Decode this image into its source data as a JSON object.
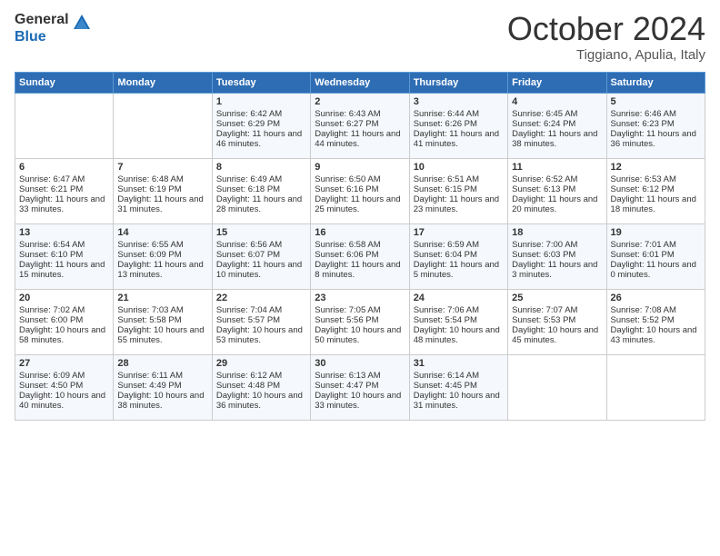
{
  "logo": {
    "general": "General",
    "blue": "Blue"
  },
  "title": "October 2024",
  "location": "Tiggiano, Apulia, Italy",
  "days_header": [
    "Sunday",
    "Monday",
    "Tuesday",
    "Wednesday",
    "Thursday",
    "Friday",
    "Saturday"
  ],
  "weeks": [
    [
      {
        "day": "",
        "sunrise": "",
        "sunset": "",
        "daylight": ""
      },
      {
        "day": "",
        "sunrise": "",
        "sunset": "",
        "daylight": ""
      },
      {
        "day": "1",
        "sunrise": "Sunrise: 6:42 AM",
        "sunset": "Sunset: 6:29 PM",
        "daylight": "Daylight: 11 hours and 46 minutes."
      },
      {
        "day": "2",
        "sunrise": "Sunrise: 6:43 AM",
        "sunset": "Sunset: 6:27 PM",
        "daylight": "Daylight: 11 hours and 44 minutes."
      },
      {
        "day": "3",
        "sunrise": "Sunrise: 6:44 AM",
        "sunset": "Sunset: 6:26 PM",
        "daylight": "Daylight: 11 hours and 41 minutes."
      },
      {
        "day": "4",
        "sunrise": "Sunrise: 6:45 AM",
        "sunset": "Sunset: 6:24 PM",
        "daylight": "Daylight: 11 hours and 38 minutes."
      },
      {
        "day": "5",
        "sunrise": "Sunrise: 6:46 AM",
        "sunset": "Sunset: 6:23 PM",
        "daylight": "Daylight: 11 hours and 36 minutes."
      }
    ],
    [
      {
        "day": "6",
        "sunrise": "Sunrise: 6:47 AM",
        "sunset": "Sunset: 6:21 PM",
        "daylight": "Daylight: 11 hours and 33 minutes."
      },
      {
        "day": "7",
        "sunrise": "Sunrise: 6:48 AM",
        "sunset": "Sunset: 6:19 PM",
        "daylight": "Daylight: 11 hours and 31 minutes."
      },
      {
        "day": "8",
        "sunrise": "Sunrise: 6:49 AM",
        "sunset": "Sunset: 6:18 PM",
        "daylight": "Daylight: 11 hours and 28 minutes."
      },
      {
        "day": "9",
        "sunrise": "Sunrise: 6:50 AM",
        "sunset": "Sunset: 6:16 PM",
        "daylight": "Daylight: 11 hours and 25 minutes."
      },
      {
        "day": "10",
        "sunrise": "Sunrise: 6:51 AM",
        "sunset": "Sunset: 6:15 PM",
        "daylight": "Daylight: 11 hours and 23 minutes."
      },
      {
        "day": "11",
        "sunrise": "Sunrise: 6:52 AM",
        "sunset": "Sunset: 6:13 PM",
        "daylight": "Daylight: 11 hours and 20 minutes."
      },
      {
        "day": "12",
        "sunrise": "Sunrise: 6:53 AM",
        "sunset": "Sunset: 6:12 PM",
        "daylight": "Daylight: 11 hours and 18 minutes."
      }
    ],
    [
      {
        "day": "13",
        "sunrise": "Sunrise: 6:54 AM",
        "sunset": "Sunset: 6:10 PM",
        "daylight": "Daylight: 11 hours and 15 minutes."
      },
      {
        "day": "14",
        "sunrise": "Sunrise: 6:55 AM",
        "sunset": "Sunset: 6:09 PM",
        "daylight": "Daylight: 11 hours and 13 minutes."
      },
      {
        "day": "15",
        "sunrise": "Sunrise: 6:56 AM",
        "sunset": "Sunset: 6:07 PM",
        "daylight": "Daylight: 11 hours and 10 minutes."
      },
      {
        "day": "16",
        "sunrise": "Sunrise: 6:58 AM",
        "sunset": "Sunset: 6:06 PM",
        "daylight": "Daylight: 11 hours and 8 minutes."
      },
      {
        "day": "17",
        "sunrise": "Sunrise: 6:59 AM",
        "sunset": "Sunset: 6:04 PM",
        "daylight": "Daylight: 11 hours and 5 minutes."
      },
      {
        "day": "18",
        "sunrise": "Sunrise: 7:00 AM",
        "sunset": "Sunset: 6:03 PM",
        "daylight": "Daylight: 11 hours and 3 minutes."
      },
      {
        "day": "19",
        "sunrise": "Sunrise: 7:01 AM",
        "sunset": "Sunset: 6:01 PM",
        "daylight": "Daylight: 11 hours and 0 minutes."
      }
    ],
    [
      {
        "day": "20",
        "sunrise": "Sunrise: 7:02 AM",
        "sunset": "Sunset: 6:00 PM",
        "daylight": "Daylight: 10 hours and 58 minutes."
      },
      {
        "day": "21",
        "sunrise": "Sunrise: 7:03 AM",
        "sunset": "Sunset: 5:58 PM",
        "daylight": "Daylight: 10 hours and 55 minutes."
      },
      {
        "day": "22",
        "sunrise": "Sunrise: 7:04 AM",
        "sunset": "Sunset: 5:57 PM",
        "daylight": "Daylight: 10 hours and 53 minutes."
      },
      {
        "day": "23",
        "sunrise": "Sunrise: 7:05 AM",
        "sunset": "Sunset: 5:56 PM",
        "daylight": "Daylight: 10 hours and 50 minutes."
      },
      {
        "day": "24",
        "sunrise": "Sunrise: 7:06 AM",
        "sunset": "Sunset: 5:54 PM",
        "daylight": "Daylight: 10 hours and 48 minutes."
      },
      {
        "day": "25",
        "sunrise": "Sunrise: 7:07 AM",
        "sunset": "Sunset: 5:53 PM",
        "daylight": "Daylight: 10 hours and 45 minutes."
      },
      {
        "day": "26",
        "sunrise": "Sunrise: 7:08 AM",
        "sunset": "Sunset: 5:52 PM",
        "daylight": "Daylight: 10 hours and 43 minutes."
      }
    ],
    [
      {
        "day": "27",
        "sunrise": "Sunrise: 6:09 AM",
        "sunset": "Sunset: 4:50 PM",
        "daylight": "Daylight: 10 hours and 40 minutes."
      },
      {
        "day": "28",
        "sunrise": "Sunrise: 6:11 AM",
        "sunset": "Sunset: 4:49 PM",
        "daylight": "Daylight: 10 hours and 38 minutes."
      },
      {
        "day": "29",
        "sunrise": "Sunrise: 6:12 AM",
        "sunset": "Sunset: 4:48 PM",
        "daylight": "Daylight: 10 hours and 36 minutes."
      },
      {
        "day": "30",
        "sunrise": "Sunrise: 6:13 AM",
        "sunset": "Sunset: 4:47 PM",
        "daylight": "Daylight: 10 hours and 33 minutes."
      },
      {
        "day": "31",
        "sunrise": "Sunrise: 6:14 AM",
        "sunset": "Sunset: 4:45 PM",
        "daylight": "Daylight: 10 hours and 31 minutes."
      },
      {
        "day": "",
        "sunrise": "",
        "sunset": "",
        "daylight": ""
      },
      {
        "day": "",
        "sunrise": "",
        "sunset": "",
        "daylight": ""
      }
    ]
  ]
}
